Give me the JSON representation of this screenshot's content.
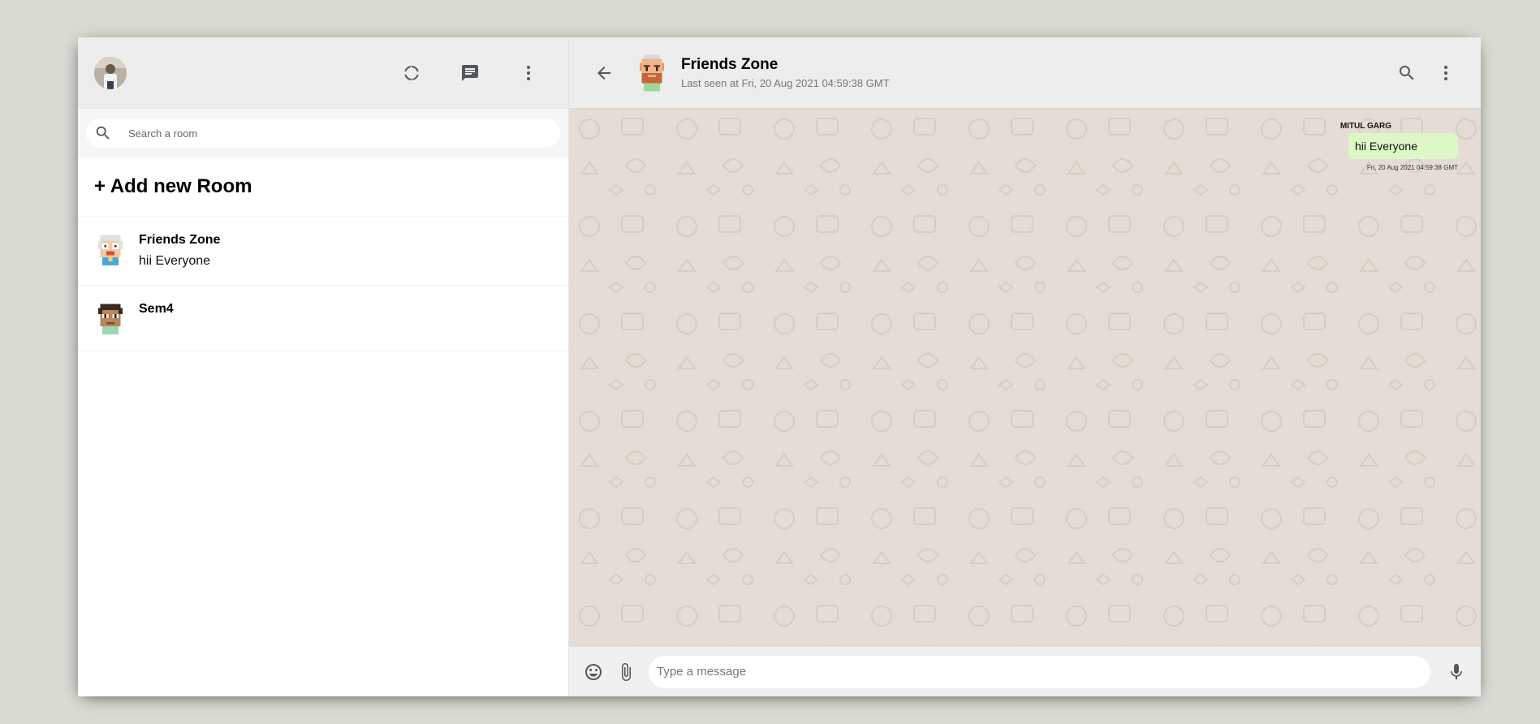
{
  "sidebar": {
    "user_avatar_icon": "user-photo-avatar",
    "header_icons": [
      "status-icon",
      "chat-icon",
      "more-vertical-icon"
    ],
    "search_placeholder": "Search a room",
    "add_room_label": "+ Add new Room",
    "rooms": [
      {
        "name": "Friends Zone",
        "last_message": "hii Everyone",
        "avatar_icon": "pixel-avatar-old-man"
      },
      {
        "name": "Sem4",
        "last_message": "",
        "avatar_icon": "pixel-avatar-boy"
      }
    ]
  },
  "chat": {
    "room_name": "Friends Zone",
    "last_seen": "Last seen at Fri, 20 Aug 2021 04:59:38 GMT",
    "header_icons": [
      "back-arrow-icon",
      "search-icon",
      "more-vertical-icon"
    ],
    "messages": [
      {
        "sender": "Mitul Garg",
        "text": "hii Everyone",
        "timestamp": "Fri, 20 Aug 2021 04:59:38 GMT",
        "is_own": true
      }
    ],
    "input_placeholder": "Type a message",
    "footer_icons": [
      "emoji-icon",
      "attach-icon",
      "mic-icon"
    ]
  },
  "colors": {
    "page_background": "#dadbd3",
    "header_background": "#ededed",
    "chat_background": "#e5ddd5",
    "own_message_bubble": "#dcf8c6"
  }
}
